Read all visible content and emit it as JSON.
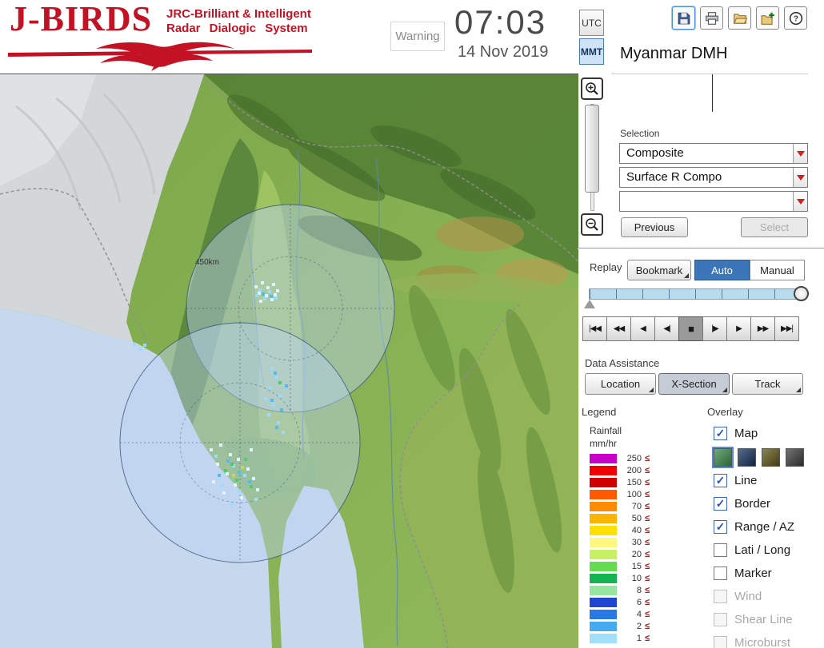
{
  "header": {
    "logo_title": "J-BIRDS",
    "logo_sub1": "JRC-Brilliant & Intelligent",
    "logo_sub2": "Radar  Dialogic  System",
    "warning": "Warning",
    "time": "07:03",
    "date": "14 Nov 2019",
    "tz_utc": "UTC",
    "tz_mmt": "MMT",
    "tz_selected": "MMT",
    "help_glyph": "?",
    "station": "Myanmar DMH"
  },
  "map": {
    "range_label": "450km"
  },
  "selection": {
    "label": "Selection",
    "dropdowns": [
      "Composite",
      "Surface R Compo",
      ""
    ],
    "previous": "Previous",
    "select": "Select",
    "select_enabled": false
  },
  "replay": {
    "label": "Replay",
    "bookmark": "Bookmark",
    "auto": "Auto",
    "manual": "Manual",
    "mode_selected": "Auto",
    "controls": [
      "|◀◀",
      "◀◀",
      "◀",
      "◀|",
      "■",
      "|▶",
      "▶",
      "▶▶",
      "▶▶|"
    ],
    "control_names": [
      "first",
      "fast-rewind",
      "rewind",
      "step-back",
      "stop",
      "step-forward",
      "play",
      "fast-forward",
      "last"
    ],
    "active_control": 4
  },
  "assist": {
    "label": "Data Assistance",
    "buttons": [
      "Location",
      "X-Section",
      "Track"
    ],
    "active": 1
  },
  "legend": {
    "label": "Legend",
    "title": "Rainfall",
    "unit": "mm/hr",
    "lte": "≤",
    "entries": [
      {
        "v": "250",
        "c": "#c800c8"
      },
      {
        "v": "200",
        "c": "#f00000"
      },
      {
        "v": "150",
        "c": "#d00000"
      },
      {
        "v": "100",
        "c": "#ff5a00"
      },
      {
        "v": "70",
        "c": "#ff8c00"
      },
      {
        "v": "50",
        "c": "#ffb400"
      },
      {
        "v": "40",
        "c": "#ffe000"
      },
      {
        "v": "30",
        "c": "#fff880"
      },
      {
        "v": "20",
        "c": "#c8f064"
      },
      {
        "v": "15",
        "c": "#64dc50"
      },
      {
        "v": "10",
        "c": "#14b450"
      },
      {
        "v": "8",
        "c": "#96e6a0"
      },
      {
        "v": "6",
        "c": "#1e46d2"
      },
      {
        "v": "4",
        "c": "#2878e6"
      },
      {
        "v": "2",
        "c": "#46aaf0"
      },
      {
        "v": "1",
        "c": "#a0e0fa"
      }
    ]
  },
  "overlay": {
    "label": "Overlay",
    "items": [
      {
        "label": "Map",
        "checked": true,
        "enabled": true
      },
      {
        "label": "Line",
        "checked": true,
        "enabled": true
      },
      {
        "label": "Border",
        "checked": true,
        "enabled": true
      },
      {
        "label": "Range / AZ",
        "checked": true,
        "enabled": true
      },
      {
        "label": "Lati / Long",
        "checked": false,
        "enabled": true
      },
      {
        "label": "Marker",
        "checked": false,
        "enabled": true
      },
      {
        "label": "Wind",
        "checked": false,
        "enabled": false
      },
      {
        "label": "Shear Line",
        "checked": false,
        "enabled": false
      },
      {
        "label": "Microburst",
        "checked": false,
        "enabled": false
      }
    ],
    "map_styles": [
      "#3c8a4a",
      "#16325e",
      "#5e5414",
      "#3c3c3c"
    ],
    "selected_style": 0
  }
}
